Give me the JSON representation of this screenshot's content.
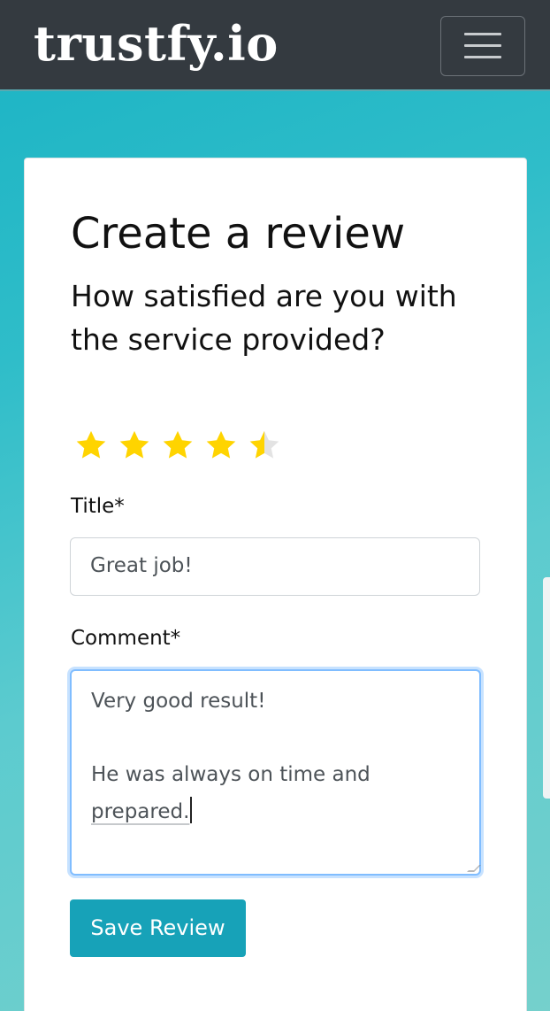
{
  "navbar": {
    "brand": "trustfy.io",
    "menu_icon": "hamburger-menu-icon"
  },
  "form": {
    "heading": "Create a review",
    "question": "How satisfied are you with the service provided?",
    "rating": {
      "value": 4.5,
      "max": 5,
      "filled_color": "#ffd400",
      "empty_color": "#e3e3e3"
    },
    "title_label": "Title*",
    "title_value": "Great job!",
    "comment_label": "Comment*",
    "comment_lines": {
      "line1": "Very good result!",
      "line2": "",
      "line3": "He was always on time and",
      "line4": "prepared."
    },
    "save_label": "Save Review"
  },
  "colors": {
    "navbar_bg": "#343a40",
    "button_bg": "#17a2b8",
    "focus_border": "#80bdff"
  }
}
